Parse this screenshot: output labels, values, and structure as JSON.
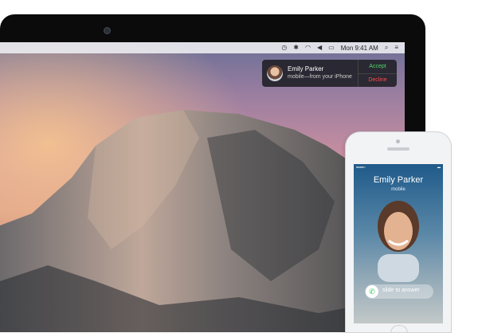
{
  "menubar": {
    "clock": "Mon 9:41 AM",
    "icons": [
      "clock-icon",
      "bluetooth-icon",
      "wifi-icon",
      "volume-icon",
      "battery-icon",
      "search-icon",
      "menu-icon"
    ]
  },
  "notification": {
    "caller_name": "Emily Parker",
    "caller_detail": "mobile—from your iPhone",
    "accept_label": "Accept",
    "decline_label": "Decline",
    "accept_color": "#4cd964",
    "decline_color": "#ff4b4b"
  },
  "iphone": {
    "caller_name": "Emily Parker",
    "caller_detail": "mobile",
    "slide_label": "slide to answer",
    "accept_color": "#34c759"
  }
}
